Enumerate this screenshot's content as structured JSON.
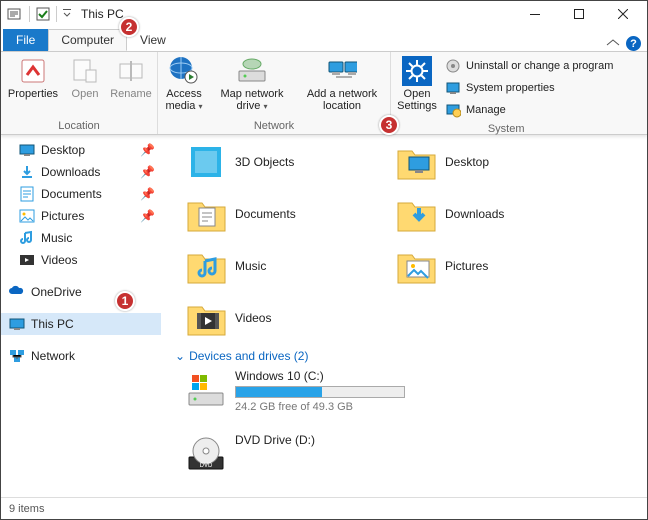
{
  "window": {
    "title": "This PC"
  },
  "tabs": {
    "file": "File",
    "computer": "Computer",
    "view": "View"
  },
  "ribbon": {
    "properties": "Properties",
    "open": "Open",
    "rename": "Rename",
    "group_location": "Location",
    "access_media": "Access media",
    "map_drive": "Map network drive",
    "add_net_loc": "Add a network location",
    "group_network": "Network",
    "open_settings": "Open Settings",
    "uninstall": "Uninstall or change a program",
    "sys_props": "System properties",
    "manage": "Manage",
    "group_system": "System"
  },
  "sidebar": {
    "items": [
      {
        "label": "Desktop",
        "icon": "desktop",
        "pinned": true
      },
      {
        "label": "Downloads",
        "icon": "downloads",
        "pinned": true
      },
      {
        "label": "Documents",
        "icon": "documents",
        "pinned": true
      },
      {
        "label": "Pictures",
        "icon": "pictures",
        "pinned": true
      },
      {
        "label": "Music",
        "icon": "music",
        "pinned": false
      },
      {
        "label": "Videos",
        "icon": "videos",
        "pinned": false
      }
    ],
    "onedrive": "OneDrive",
    "thispc": "This PC",
    "network": "Network"
  },
  "content": {
    "folders": [
      {
        "label": "3D Objects",
        "icon": "3d"
      },
      {
        "label": "Desktop",
        "icon": "desktop-big"
      },
      {
        "label": "Documents",
        "icon": "documents-big"
      },
      {
        "label": "Downloads",
        "icon": "downloads-big"
      },
      {
        "label": "Music",
        "icon": "music-big"
      },
      {
        "label": "Pictures",
        "icon": "pictures-big"
      },
      {
        "label": "Videos",
        "icon": "videos-big"
      }
    ],
    "drives_header": "Devices and drives (2)",
    "drives": [
      {
        "name": "Windows 10 (C:)",
        "free": "24.2 GB free of 49.3 GB",
        "fill": 51,
        "icon": "windisk"
      },
      {
        "name": "DVD Drive (D:)",
        "free": "",
        "fill": 0,
        "icon": "dvd"
      }
    ]
  },
  "status": {
    "items_text": "9 items"
  },
  "annotations": {
    "a1": "1",
    "a2": "2",
    "a3": "3"
  }
}
